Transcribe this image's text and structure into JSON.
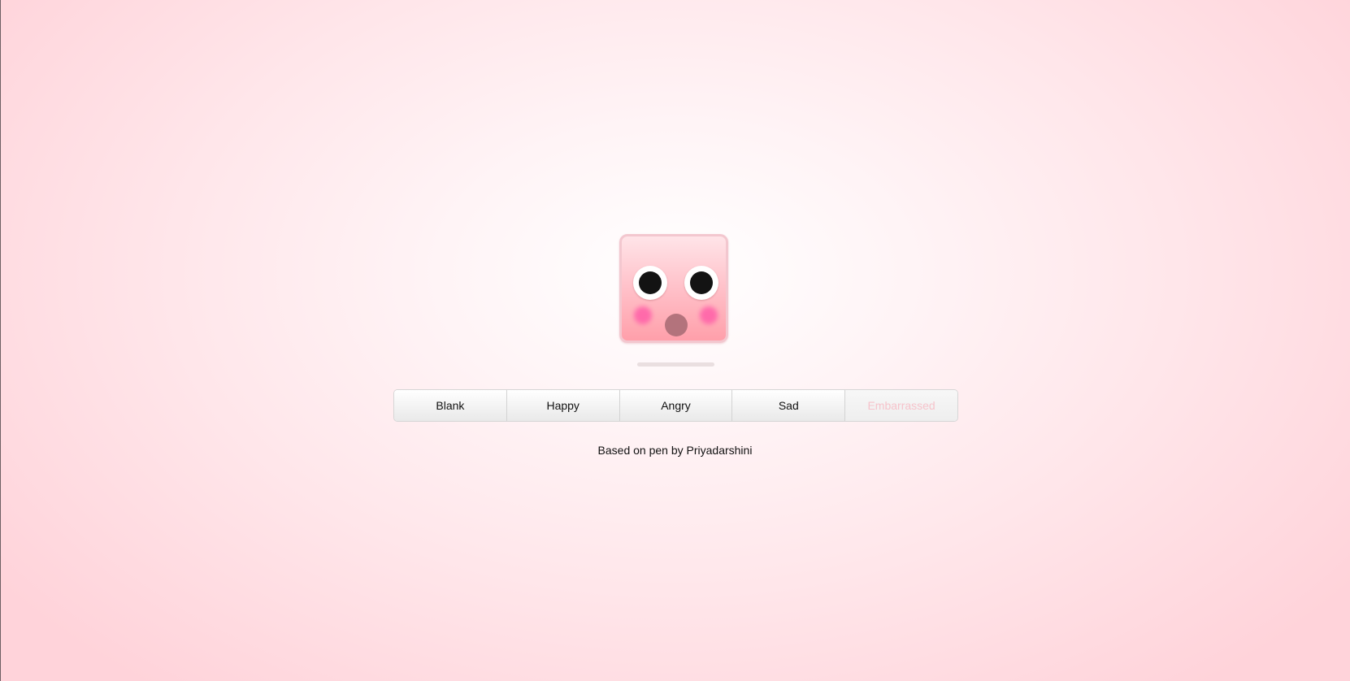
{
  "emoji": {
    "expression": "Embarrassed"
  },
  "buttons": [
    {
      "label": "Blank",
      "active": false
    },
    {
      "label": "Happy",
      "active": false
    },
    {
      "label": "Angry",
      "active": false
    },
    {
      "label": "Sad",
      "active": false
    },
    {
      "label": "Embarrassed",
      "active": true
    }
  ],
  "footer": {
    "credit": "Based on pen by Priyadarshini"
  },
  "colors": {
    "face_top": "#ffe4e8",
    "face_bottom": "#ff9faa",
    "cheek": "#ff5fa8",
    "mouth": "#b3737c",
    "active_label": "#f6c3cb"
  }
}
